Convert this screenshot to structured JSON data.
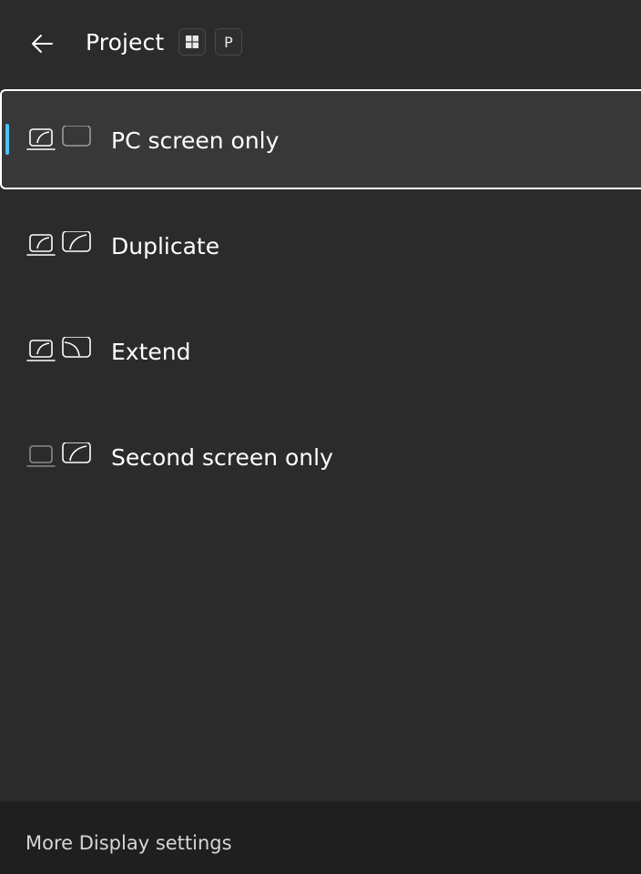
{
  "header": {
    "title": "Project",
    "back_icon": "back-arrow-icon",
    "shortcut_keys": [
      "windows-key-icon",
      "P"
    ]
  },
  "options": [
    {
      "label": "PC screen only",
      "icon": "pc-screen-only-icon",
      "selected": true
    },
    {
      "label": "Duplicate",
      "icon": "duplicate-icon",
      "selected": false
    },
    {
      "label": "Extend",
      "icon": "extend-icon",
      "selected": false
    },
    {
      "label": "Second screen only",
      "icon": "second-screen-only-icon",
      "selected": false
    }
  ],
  "footer": {
    "link_label": "More Display settings"
  },
  "colors": {
    "background": "#2b2b2b",
    "selected_background": "#383838",
    "accent": "#4cc2ff",
    "footer_background": "#1f1f1f"
  }
}
